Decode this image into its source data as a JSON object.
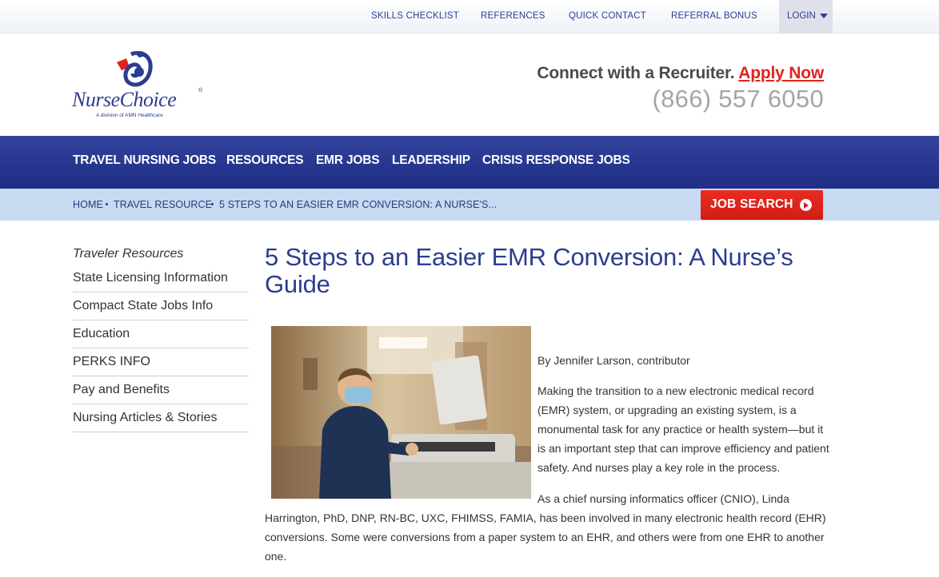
{
  "utility_nav": {
    "items": [
      "SKILLS CHECKLIST",
      "REFERENCES",
      "QUICK CONTACT",
      "REFERRAL BONUS"
    ],
    "login_label": "LOGIN"
  },
  "header": {
    "logo_text": "NurseChoice",
    "logo_subtitle": "A division of AMN Healthcare",
    "recruiter_text": "Connect with a Recruiter.",
    "apply_label": "Apply Now",
    "phone": "(866) 557 6050"
  },
  "main_nav": {
    "items": [
      "TRAVEL NURSING JOBS",
      "RESOURCES",
      "EMR JOBS",
      "LEADERSHIP",
      "CRISIS RESPONSE JOBS"
    ]
  },
  "breadcrumb": {
    "items": [
      "HOME",
      "TRAVEL RESOURCE",
      "5 STEPS TO AN EASIER EMR CONVERSION: A NURSE'S..."
    ]
  },
  "job_search_label": "JOB SEARCH",
  "sidebar": {
    "heading": "Traveler Resources",
    "items": [
      "State Licensing Information",
      "Compact State Jobs Info",
      "Education",
      "PERKS INFO",
      "Pay and Benefits",
      "Nursing Articles & Stories"
    ]
  },
  "article": {
    "title": "5 Steps to an Easier EMR Conversion: A Nurse’s Guide",
    "byline": "By Jennifer Larson, contributor",
    "paragraph1": "Making the transition to a new electronic medical record (EMR) system, or upgrading an existing system, is a monumental task for any practice or health system—but it is an important step that can improve efficiency and patient safety. And nurses play a key role in the process.",
    "paragraph2_start": "As a chief nursing informatics officer (CNIO), Linda",
    "paragraph2_rest": "Harrington, PhD, DNP, RN-BC, UXC, FHIMSS, FAMIA, has been involved in many electronic health record (EHR) conversions. Some were conversions from a paper system to an EHR, and others were from one EHR to another one."
  },
  "colors": {
    "brand_blue": "#2b3d8f",
    "nav_blue": "#27378f",
    "accent_red": "#e0241b",
    "breadcrumb_bg": "#c7daf1"
  }
}
